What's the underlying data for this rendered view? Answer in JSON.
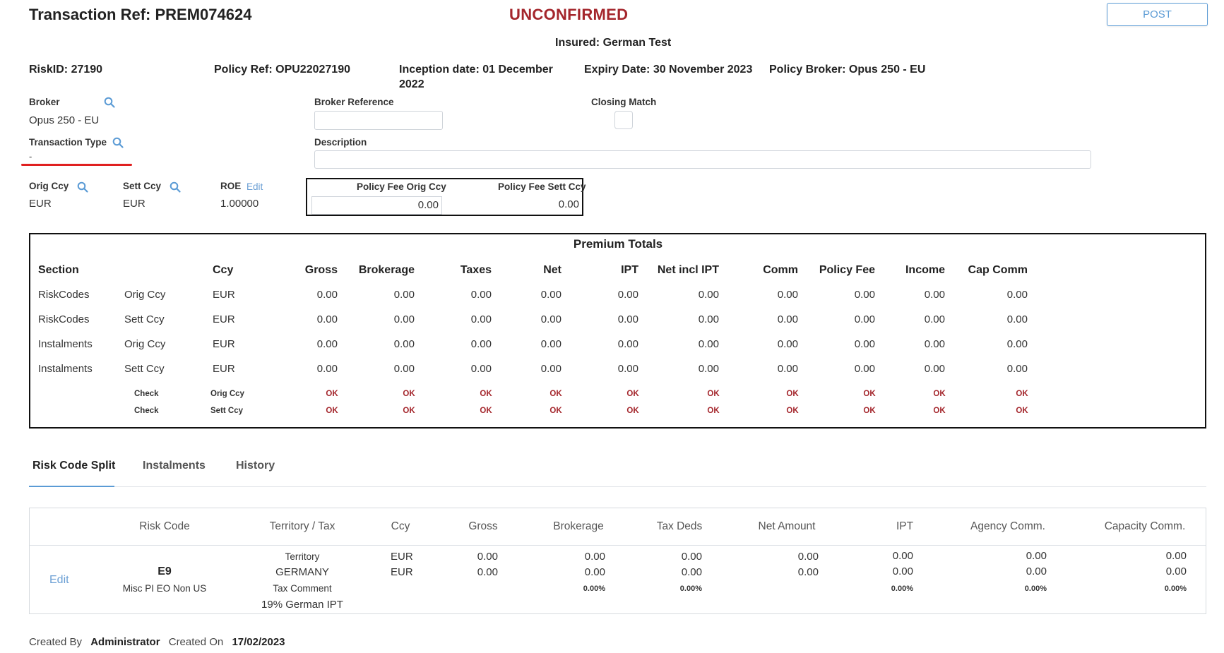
{
  "header": {
    "title": "Transaction Ref: PREM074624",
    "status": "UNCONFIRMED",
    "post_label": "POST",
    "insured": "Insured: German Test"
  },
  "info": {
    "risk_id": "RiskID: 27190",
    "policy_ref": "Policy Ref: OPU22027190",
    "inception_line1": "Inception date: 01 December",
    "inception_line2": "2022",
    "expiry": "Expiry Date: 30 November 2023",
    "policy_broker": "Policy Broker: Opus 250 - EU"
  },
  "form": {
    "broker_label": "Broker",
    "broker_value": "Opus 250 - EU",
    "broker_ref_label": "Broker Reference",
    "broker_ref_value": "",
    "closing_match_label": "Closing Match",
    "transaction_type_label": "Transaction Type",
    "transaction_type_value": "-",
    "description_label": "Description",
    "description_value": "",
    "orig_ccy_label": "Orig Ccy",
    "orig_ccy_value": "EUR",
    "sett_ccy_label": "Sett Ccy",
    "sett_ccy_value": "EUR",
    "roe_label": "ROE",
    "roe_edit": "Edit",
    "roe_value": "1.00000",
    "fee_orig_label": "Policy Fee Orig Ccy",
    "fee_orig_value": "0.00",
    "fee_sett_label": "Policy Fee Sett Ccy",
    "fee_sett_value": "0.00"
  },
  "totals": {
    "title": "Premium Totals",
    "headers": [
      "Section",
      "Ccy",
      "Gross",
      "Brokerage",
      "Taxes",
      "Net",
      "IPT",
      "Net incl IPT",
      "Comm",
      "Policy Fee",
      "Income",
      "Cap Comm"
    ],
    "rows": [
      {
        "section": "RiskCodes",
        "type": "Orig Ccy",
        "ccy": "EUR",
        "values": [
          "0.00",
          "0.00",
          "0.00",
          "0.00",
          "0.00",
          "0.00",
          "0.00",
          "0.00",
          "0.00",
          "0.00"
        ]
      },
      {
        "section": "RiskCodes",
        "type": "Sett Ccy",
        "ccy": "EUR",
        "values": [
          "0.00",
          "0.00",
          "0.00",
          "0.00",
          "0.00",
          "0.00",
          "0.00",
          "0.00",
          "0.00",
          "0.00"
        ]
      },
      {
        "section": "Instalments",
        "type": "Orig Ccy",
        "ccy": "EUR",
        "values": [
          "0.00",
          "0.00",
          "0.00",
          "0.00",
          "0.00",
          "0.00",
          "0.00",
          "0.00",
          "0.00",
          "0.00"
        ]
      },
      {
        "section": "Instalments",
        "type": "Sett Ccy",
        "ccy": "EUR",
        "values": [
          "0.00",
          "0.00",
          "0.00",
          "0.00",
          "0.00",
          "0.00",
          "0.00",
          "0.00",
          "0.00",
          "0.00"
        ]
      }
    ],
    "checks": [
      {
        "label": "Check",
        "ccy": "Orig Ccy",
        "values": [
          "OK",
          "OK",
          "OK",
          "OK",
          "OK",
          "OK",
          "OK",
          "OK",
          "OK",
          "OK"
        ]
      },
      {
        "label": "Check",
        "ccy": "Sett Ccy",
        "values": [
          "OK",
          "OK",
          "OK",
          "OK",
          "OK",
          "OK",
          "OK",
          "OK",
          "OK",
          "OK"
        ]
      }
    ]
  },
  "tabs": [
    "Risk Code Split",
    "Instalments",
    "History"
  ],
  "split": {
    "headers": [
      "Risk Code",
      "Territory / Tax",
      "Ccy",
      "Gross",
      "Brokerage",
      "Tax Deds",
      "Net Amount",
      "IPT",
      "Agency Comm.",
      "Capacity Comm."
    ],
    "row": {
      "edit": "Edit",
      "code": "E9",
      "code_desc": "Misc PI EO Non US",
      "territory_label": "Territory",
      "territory": "GERMANY",
      "tax_comment_label": "Tax Comment",
      "tax_comment": "19% German IPT",
      "ccy1": "EUR",
      "ccy2": "EUR",
      "gross1": "0.00",
      "gross2": "0.00",
      "brokerage1": "0.00",
      "brokerage2": "0.00",
      "brokerage_pct": "0.00%",
      "taxdeds1": "0.00",
      "taxdeds2": "0.00",
      "taxdeds_pct": "0.00%",
      "net1": "0.00",
      "net2": "0.00",
      "ipt1": "0.00",
      "ipt2": "0.00",
      "ipt_pct": "0.00%",
      "agency1": "0.00",
      "agency2": "0.00",
      "agency_pct": "0.00%",
      "capacity1": "0.00",
      "capacity2": "0.00",
      "capacity_pct": "0.00%"
    }
  },
  "footer": {
    "created_by_label": "Created By",
    "created_by": "Administrator",
    "created_on_label": "Created On",
    "created_on": "17/02/2023"
  },
  "colors": {
    "status_red": "#a4262c",
    "link_blue": "#6b9fd4",
    "underline_red": "#e02020"
  }
}
